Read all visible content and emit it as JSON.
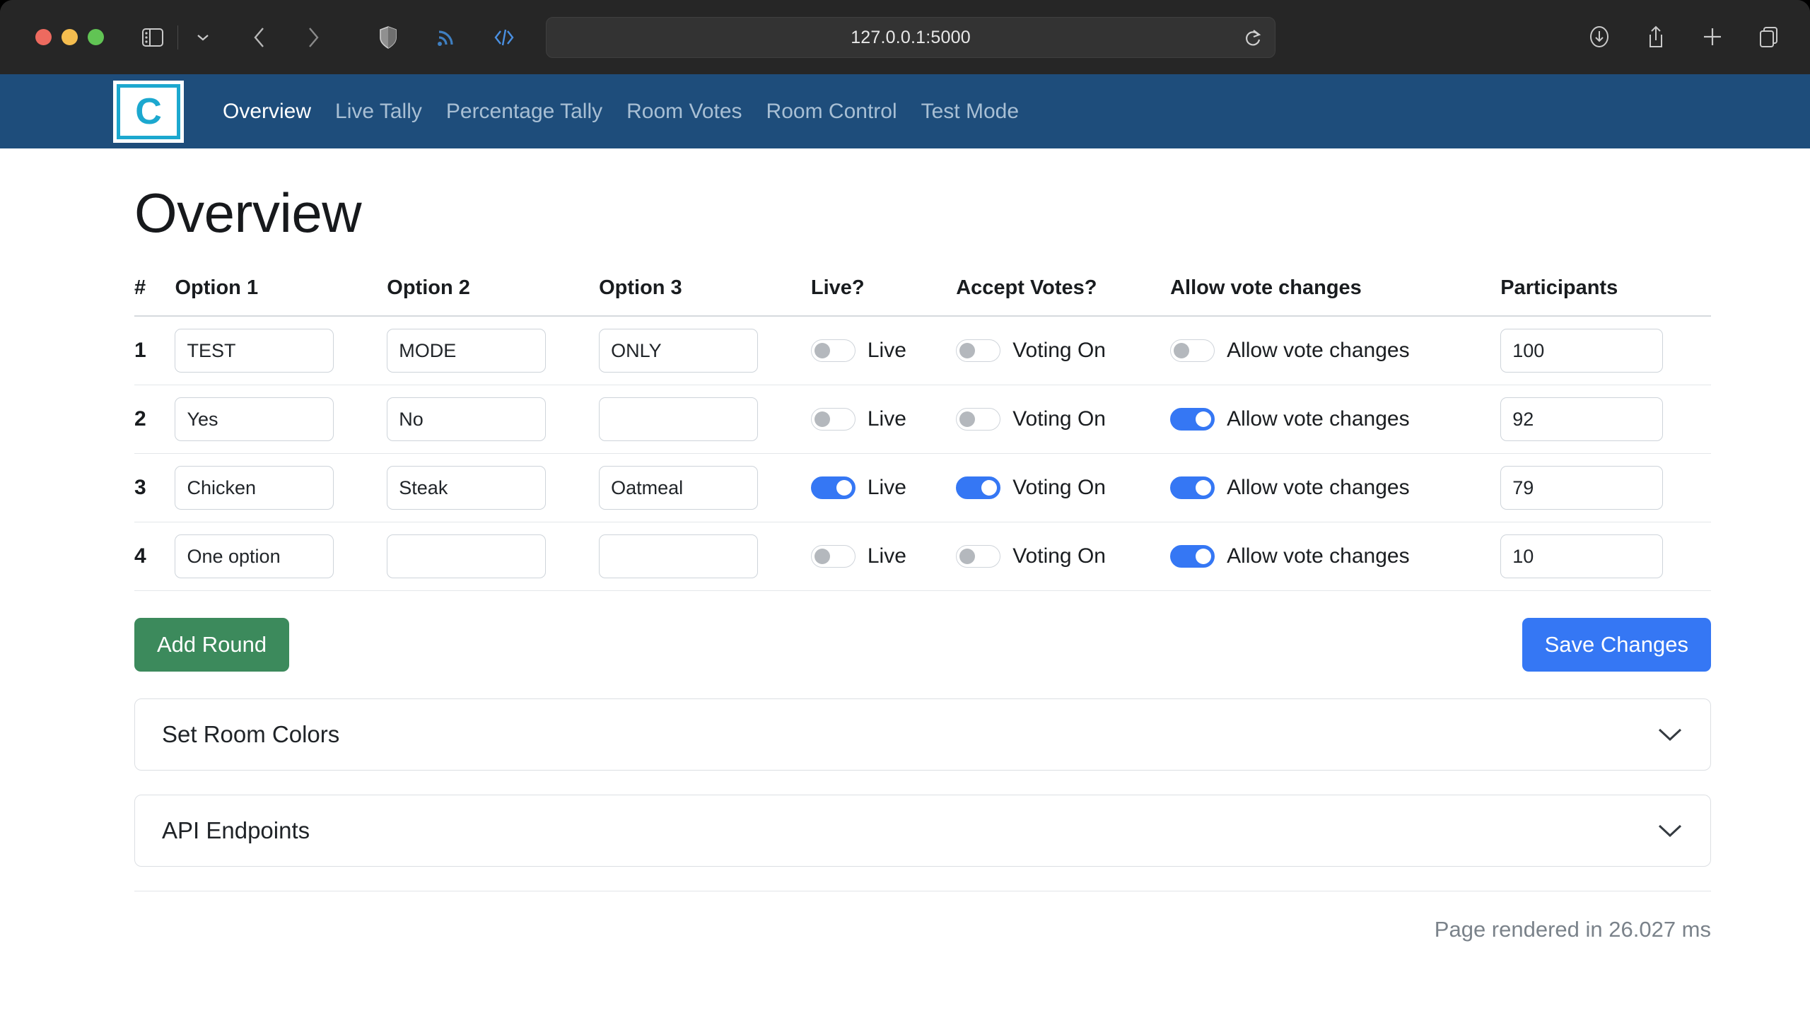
{
  "browser": {
    "url": "127.0.0.1:5000",
    "toolbar_left_icons": [
      "sidebar-toggle-icon",
      "chevron-down-icon",
      "back-icon",
      "forward-icon",
      "shield-icon",
      "rss-icon",
      "code-icon",
      "onepassword-icon"
    ],
    "toolbar_right_icons": [
      "downloads-icon",
      "share-icon",
      "new-tab-icon",
      "tab-overview-icon"
    ],
    "reload_icon": "reload-icon"
  },
  "nav": {
    "logo_letter": "C",
    "links": [
      {
        "label": "Overview",
        "active": true
      },
      {
        "label": "Live Tally",
        "active": false
      },
      {
        "label": "Percentage Tally",
        "active": false
      },
      {
        "label": "Room Votes",
        "active": false
      },
      {
        "label": "Room Control",
        "active": false
      },
      {
        "label": "Test Mode",
        "active": false
      }
    ]
  },
  "page": {
    "title": "Overview"
  },
  "table": {
    "headers": [
      "#",
      "Option 1",
      "Option 2",
      "Option 3",
      "Live?",
      "Accept Votes?",
      "Allow vote changes",
      "Participants"
    ],
    "labels": {
      "live": "Live",
      "accept": "Voting On",
      "allow": "Allow vote changes"
    },
    "rows": [
      {
        "num": "1",
        "option1": "TEST",
        "option2": "MODE",
        "option3": "ONLY",
        "live": false,
        "accept": false,
        "allow": false,
        "participants": "100"
      },
      {
        "num": "2",
        "option1": "Yes",
        "option2": "No",
        "option3": "",
        "live": false,
        "accept": false,
        "allow": true,
        "participants": "92"
      },
      {
        "num": "3",
        "option1": "Chicken",
        "option2": "Steak",
        "option3": "Oatmeal",
        "live": true,
        "accept": true,
        "allow": true,
        "participants": "79"
      },
      {
        "num": "4",
        "option1": "One option",
        "option2": "",
        "option3": "",
        "live": false,
        "accept": false,
        "allow": true,
        "participants": "10"
      }
    ]
  },
  "buttons": {
    "add_round": "Add Round",
    "save_changes": "Save Changes"
  },
  "accordions": [
    {
      "title": "Set Room Colors",
      "icon": "chevron-down-icon"
    },
    {
      "title": "API Endpoints",
      "icon": "chevron-down-icon"
    }
  ],
  "footer": {
    "render_time": "Page rendered in 26.027 ms"
  },
  "colors": {
    "navbar": "#1e4d7b",
    "logo_accent": "#1ca8cf",
    "toggle_on": "#3577f4",
    "primary_button": "#3577f4",
    "success_button": "#3c8a5c",
    "muted_text": "#7a828a"
  }
}
